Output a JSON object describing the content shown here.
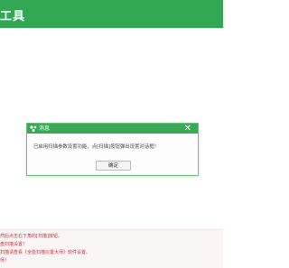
{
  "header": {
    "title": "工具"
  },
  "dialog": {
    "title": "消息",
    "close_icon": "✕",
    "message": "已启用扫描参数设置功能，点[扫描]按钮弹出设置对话框！",
    "ok_label": "确定"
  },
  "footer": {
    "lines": [
      "然后点击右下角的[扫描]按钮。",
      "盘扫描设置！",
      "扫描请查看《全能扫描仪置大师》软件设置。",
      "师！"
    ]
  },
  "colors": {
    "header_green": "#32a854",
    "dialog_titlebar_green": "#3aa957",
    "footer_text_red": "#d0303a"
  }
}
